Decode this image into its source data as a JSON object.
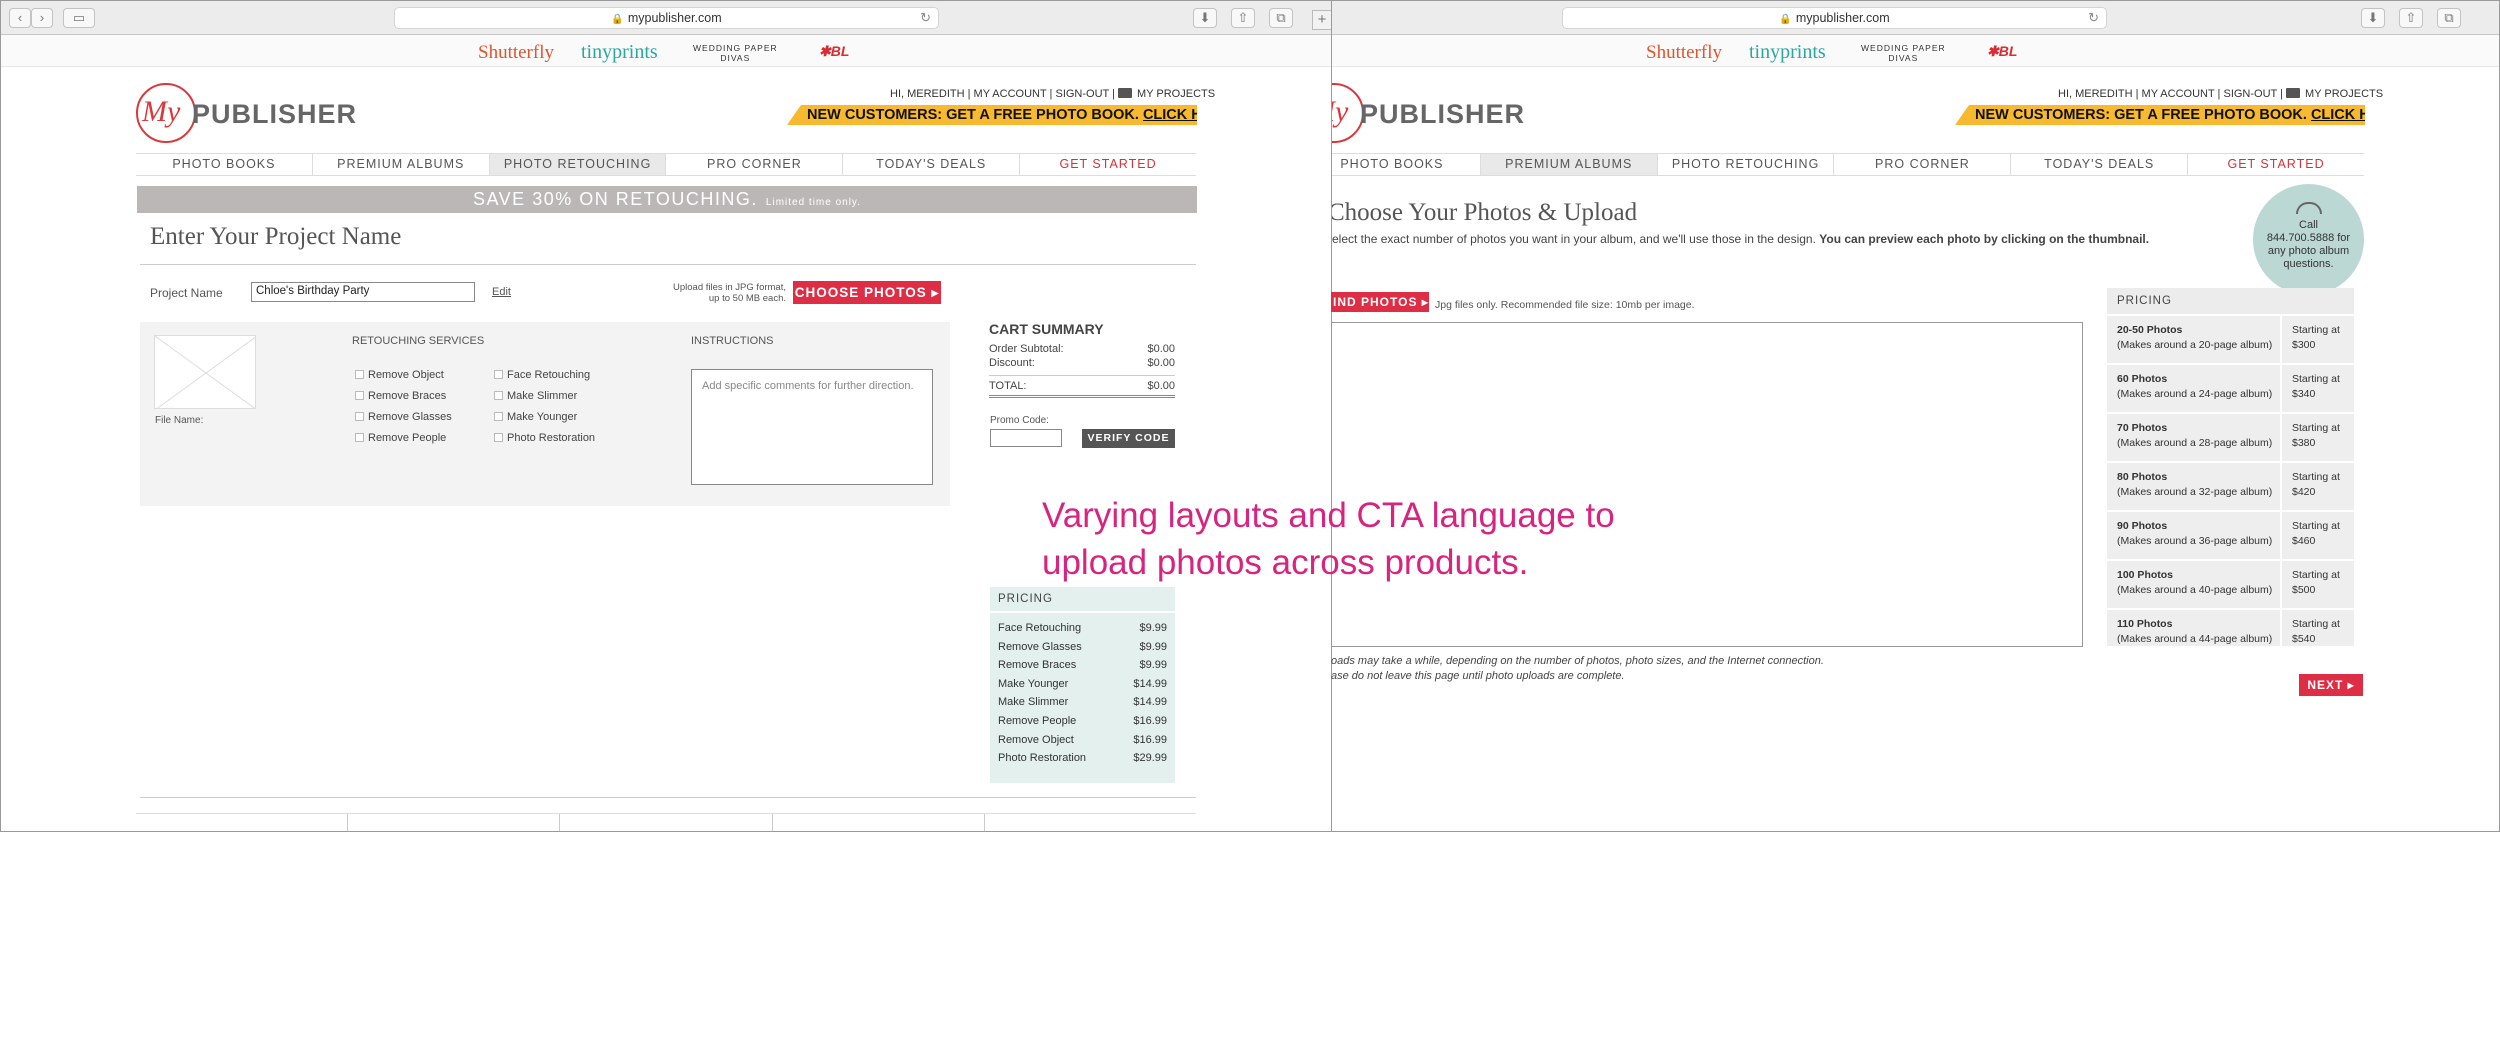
{
  "left": {
    "url": "mypublisher.com",
    "brands": {
      "shutterfly": "Shutterfly",
      "tinyprints": "tinyprints",
      "wpd_line1": "WEDDING PAPER",
      "wpd_line2": "DIVAS",
      "bl": "BL"
    },
    "logo": {
      "my": "My",
      "publisher": "PUBLISHER"
    },
    "toplinks": {
      "greeting": "HI, MEREDITH",
      "account": "MY ACCOUNT",
      "signout": "SIGN-OUT",
      "projects": "MY PROJECTS"
    },
    "promo": {
      "text": "NEW CUSTOMERS: GET A FREE PHOTO BOOK.",
      "link": "CLICK HERE"
    },
    "nav": [
      "PHOTO BOOKS",
      "PREMIUM ALBUMS",
      "PHOTO RETOUCHING",
      "PRO CORNER",
      "TODAY'S DEALS",
      "GET STARTED"
    ],
    "sale": {
      "main": "SAVE 30% ON RETOUCHING.",
      "sub": "Limited time only."
    },
    "title": "Enter Your Project Name",
    "project": {
      "label": "Project Name",
      "value": "Chloe's Birthday Party",
      "edit": "Edit",
      "upload_note_1": "Upload files in JPG format,",
      "upload_note_2": "up to 50 MB each.",
      "choose": "CHOOSE PHOTOS ▸"
    },
    "retouch": {
      "file_name_label": "File Name:",
      "services_heading": "RETOUCHING SERVICES",
      "col1": [
        "Remove Object",
        "Remove Braces",
        "Remove Glasses",
        "Remove People"
      ],
      "col2": [
        "Face Retouching",
        "Make Slimmer",
        "Make Younger",
        "Photo Restoration"
      ],
      "instructions_heading": "INSTRUCTIONS",
      "instructions_placeholder": "Add specific comments for further direction."
    },
    "cart": {
      "title": "CART SUMMARY",
      "rows": [
        {
          "label": "Order Subtotal:",
          "value": "$0.00"
        },
        {
          "label": "Discount:",
          "value": "$0.00"
        }
      ],
      "total_label": "TOTAL:",
      "total_value": "$0.00",
      "promo_label": "Promo Code:",
      "verify": "VERIFY CODE"
    },
    "pricing": {
      "heading": "PRICING",
      "items": [
        {
          "name": "Face Retouching",
          "price": "$9.99"
        },
        {
          "name": "Remove Glasses",
          "price": "$9.99"
        },
        {
          "name": "Remove Braces",
          "price": "$9.99"
        },
        {
          "name": "Make Younger",
          "price": "$14.99"
        },
        {
          "name": "Make Slimmer",
          "price": "$14.99"
        },
        {
          "name": "Remove People",
          "price": "$16.99"
        },
        {
          "name": "Remove Object",
          "price": "$16.99"
        },
        {
          "name": "Photo Restoration",
          "price": "$29.99"
        }
      ]
    }
  },
  "right": {
    "url": "mypublisher.com",
    "title": "Choose Your Photos & Upload",
    "subtitle": "elect the exact number of photos you want in your album, and we'll use those in the design.",
    "subtitle_bold": "You can preview each photo by clicking on the thumbnail.",
    "call": {
      "line1": "Call",
      "line2": "844.700.5888 for",
      "line3": "any photo album",
      "line4": "questions."
    },
    "find": "IND PHOTOS ▸",
    "find_note": "Jpg files only. Recommended file size: 10mb per image.",
    "pricing": {
      "heading": "PRICING",
      "items": [
        {
          "name": "20-50 Photos",
          "desc": "(Makes around a 20-page album)",
          "from": "Starting at",
          "price": "$300"
        },
        {
          "name": "60 Photos",
          "desc": "(Makes around a 24-page album)",
          "from": "Starting at",
          "price": "$340"
        },
        {
          "name": "70 Photos",
          "desc": "(Makes around a 28-page album)",
          "from": "Starting at",
          "price": "$380"
        },
        {
          "name": "80 Photos",
          "desc": "(Makes around a 32-page album)",
          "from": "Starting at",
          "price": "$420"
        },
        {
          "name": "90 Photos",
          "desc": "(Makes around a 36-page album)",
          "from": "Starting at",
          "price": "$460"
        },
        {
          "name": "100 Photos",
          "desc": "(Makes around a 40-page album)",
          "from": "Starting at",
          "price": "$500"
        },
        {
          "name": "110 Photos",
          "desc": "(Makes around a 44-page album)",
          "from": "Starting at",
          "price": "$540"
        }
      ]
    },
    "note1": "oads may take a while, depending on the number of photos, photo sizes, and the Internet connection.",
    "note2": "ase do not leave this page until photo uploads are complete.",
    "next": "NEXT ▸"
  },
  "annotation": {
    "line1": "Varying layouts and CTA language to",
    "line2": "upload photos across products."
  }
}
